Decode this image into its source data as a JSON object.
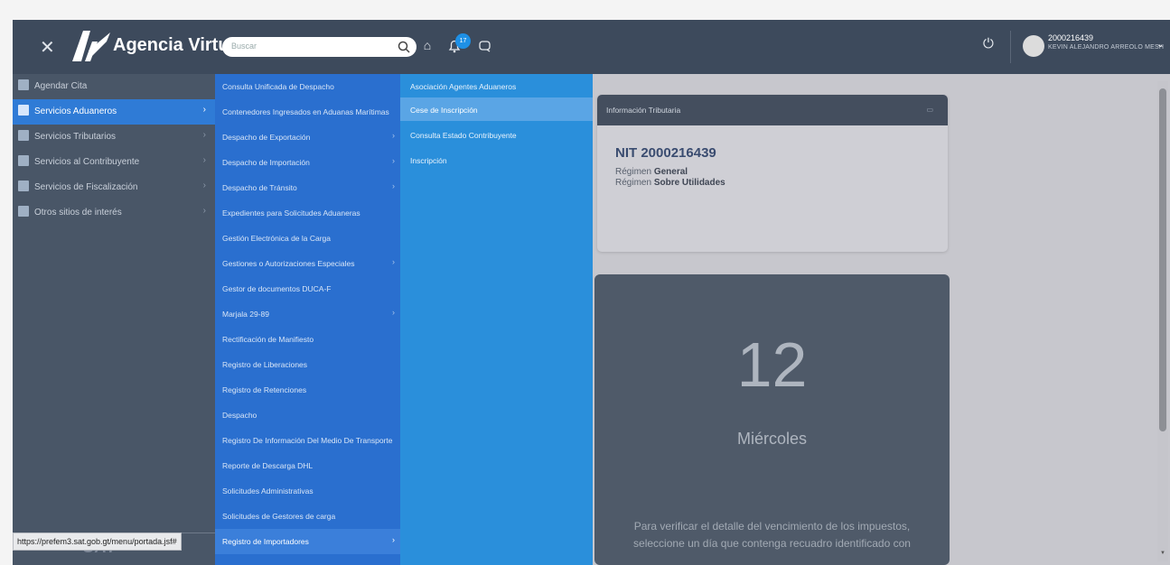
{
  "app": {
    "title": "Agencia Virtual",
    "close_icon": "close-icon"
  },
  "search": {
    "placeholder": "Buscar"
  },
  "notifications": {
    "count": "17"
  },
  "user": {
    "id": "2000216439",
    "name": "KEVIN ALEJANDRO ARREOLO MESH"
  },
  "sidebar": {
    "items": [
      {
        "label": "Agendar Cita",
        "icon": "calendar-icon",
        "has_arrow": false
      },
      {
        "label": "Servicios Aduaneros",
        "icon": "customs-icon",
        "has_arrow": true,
        "active": true
      },
      {
        "label": "Servicios Tributarios",
        "icon": "tax-icon",
        "has_arrow": true
      },
      {
        "label": "Servicios al Contribuyente",
        "icon": "document-icon",
        "has_arrow": true
      },
      {
        "label": "Servicios de Fiscalización",
        "icon": "audit-icon",
        "has_arrow": true
      },
      {
        "label": "Otros sitios de interés",
        "icon": "link-icon",
        "has_arrow": true
      }
    ],
    "footer_logo": "SAT"
  },
  "status_url": "https://prefem3.sat.gob.gt/menu/portada.jsf#",
  "submenu": {
    "items": [
      {
        "label": "Consulta Unificada de Despacho",
        "has_arrow": false
      },
      {
        "label": "Contenedores Ingresados en Aduanas Marítimas",
        "has_arrow": false
      },
      {
        "label": "Despacho de Exportación",
        "has_arrow": true
      },
      {
        "label": "Despacho de Importación",
        "has_arrow": true
      },
      {
        "label": "Despacho de Tránsito",
        "has_arrow": true
      },
      {
        "label": "Expedientes para Solicitudes Aduaneras",
        "has_arrow": false
      },
      {
        "label": "Gestión Electrónica de la Carga",
        "has_arrow": false
      },
      {
        "label": "Gestiones o Autorizaciones Especiales",
        "has_arrow": true
      },
      {
        "label": "Gestor de documentos DUCA-F",
        "has_arrow": false
      },
      {
        "label": "Marjala 29-89",
        "has_arrow": true
      },
      {
        "label": "Rectificación de Manifiesto",
        "has_arrow": false
      },
      {
        "label": "Registro de Liberaciones",
        "has_arrow": false
      },
      {
        "label": "Registro de Retenciones",
        "has_arrow": false
      },
      {
        "label": "Despacho",
        "has_arrow": false
      },
      {
        "label": "Registro De Información Del Medio De Transporte",
        "has_arrow": false
      },
      {
        "label": "Reporte de Descarga DHL",
        "has_arrow": false
      },
      {
        "label": "Solicitudes Administrativas",
        "has_arrow": false
      },
      {
        "label": "Solicitudes de Gestores de carga",
        "has_arrow": false
      },
      {
        "label": "Registro de Importadores",
        "has_arrow": true,
        "active": true
      }
    ]
  },
  "submenu3": {
    "items": [
      {
        "label": "Asociación Agentes Aduaneros"
      },
      {
        "label": "Cese de Inscripción",
        "active": true
      },
      {
        "label": "Consulta Estado Contribuyente"
      },
      {
        "label": "Inscripción"
      }
    ]
  },
  "tax_card": {
    "header": "Información Tributaria",
    "nit": "NIT 2000216439",
    "regimen_prefix": "Régimen",
    "regimen_1": "General",
    "regimen_2": "Sobre Utilidades"
  },
  "calendar_card": {
    "day_number": "12",
    "day_name": "Miércoles",
    "note_line1": "Para verificar el detalle del vencimiento de los impuestos,",
    "note_line2": "seleccione un día que contenga recuadro identificado con"
  },
  "colors": {
    "topbar": "#3d4a5c",
    "sidebar": "#495667",
    "sidebar_active": "#2f7bd6",
    "submenu": "#2a6fcf",
    "submenu3": "#2a8fdb",
    "accent": "#1e90e6"
  }
}
